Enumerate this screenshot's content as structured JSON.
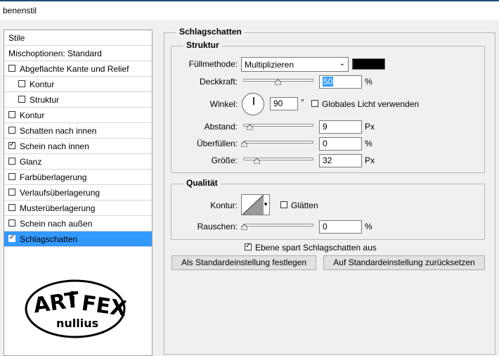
{
  "window": {
    "title": "benenstil"
  },
  "left_panel": {
    "header": "Stile",
    "mix_options": "Mischoptionen: Standard",
    "items": [
      {
        "label": "Abgeflachte Kante und Relief",
        "checked": false
      },
      {
        "label": "Kontur",
        "checked": false
      },
      {
        "label": "Struktur",
        "checked": false
      },
      {
        "label": "Kontur",
        "checked": false
      },
      {
        "label": "Schatten nach innen",
        "checked": false
      },
      {
        "label": "Schein nach innen",
        "checked": true
      },
      {
        "label": "Glanz",
        "checked": false
      },
      {
        "label": "Farbüberlagerung",
        "checked": false
      },
      {
        "label": "Verlaufsüberlagerung",
        "checked": false
      },
      {
        "label": "Musterüberlagerung",
        "checked": false
      },
      {
        "label": "Schein nach außen",
        "checked": false
      },
      {
        "label": "Schlagschatten",
        "checked": true,
        "selected": true
      }
    ],
    "logo": {
      "top_text": "ART i FEX",
      "bottom_text": "nullius"
    }
  },
  "schlagschatten": {
    "title": "Schlagschatten",
    "struktur": {
      "title": "Struktur",
      "fill_method_label": "Füllmethode:",
      "fill_method_value": "Multiplizieren",
      "color": "#000000",
      "opacity_label": "Deckkraft:",
      "opacity_value": "50",
      "opacity_unit": "%",
      "angle_label": "Winkel:",
      "angle_value": "90",
      "angle_unit": "°",
      "global_light_label": "Globales Licht verwenden",
      "global_light_checked": false,
      "distance_label": "Abstand:",
      "distance_value": "9",
      "distance_unit": "Px",
      "spread_label": "Überfüllen:",
      "spread_value": "0",
      "spread_unit": "%",
      "size_label": "Größe:",
      "size_value": "32",
      "size_unit": "Px"
    },
    "qualitaet": {
      "title": "Qualität",
      "contour_label": "Kontur:",
      "smooth_label": "Glätten",
      "smooth_checked": false,
      "noise_label": "Rauschen:",
      "noise_value": "0",
      "noise_unit": "%"
    },
    "layer_knockout_label": "Ebene spart Schlagschatten aus",
    "layer_knockout_checked": true,
    "make_default_button": "Als Standardeinstellung festlegen",
    "reset_default_button": "Auf Standardeinstellung zurücksetzen"
  }
}
